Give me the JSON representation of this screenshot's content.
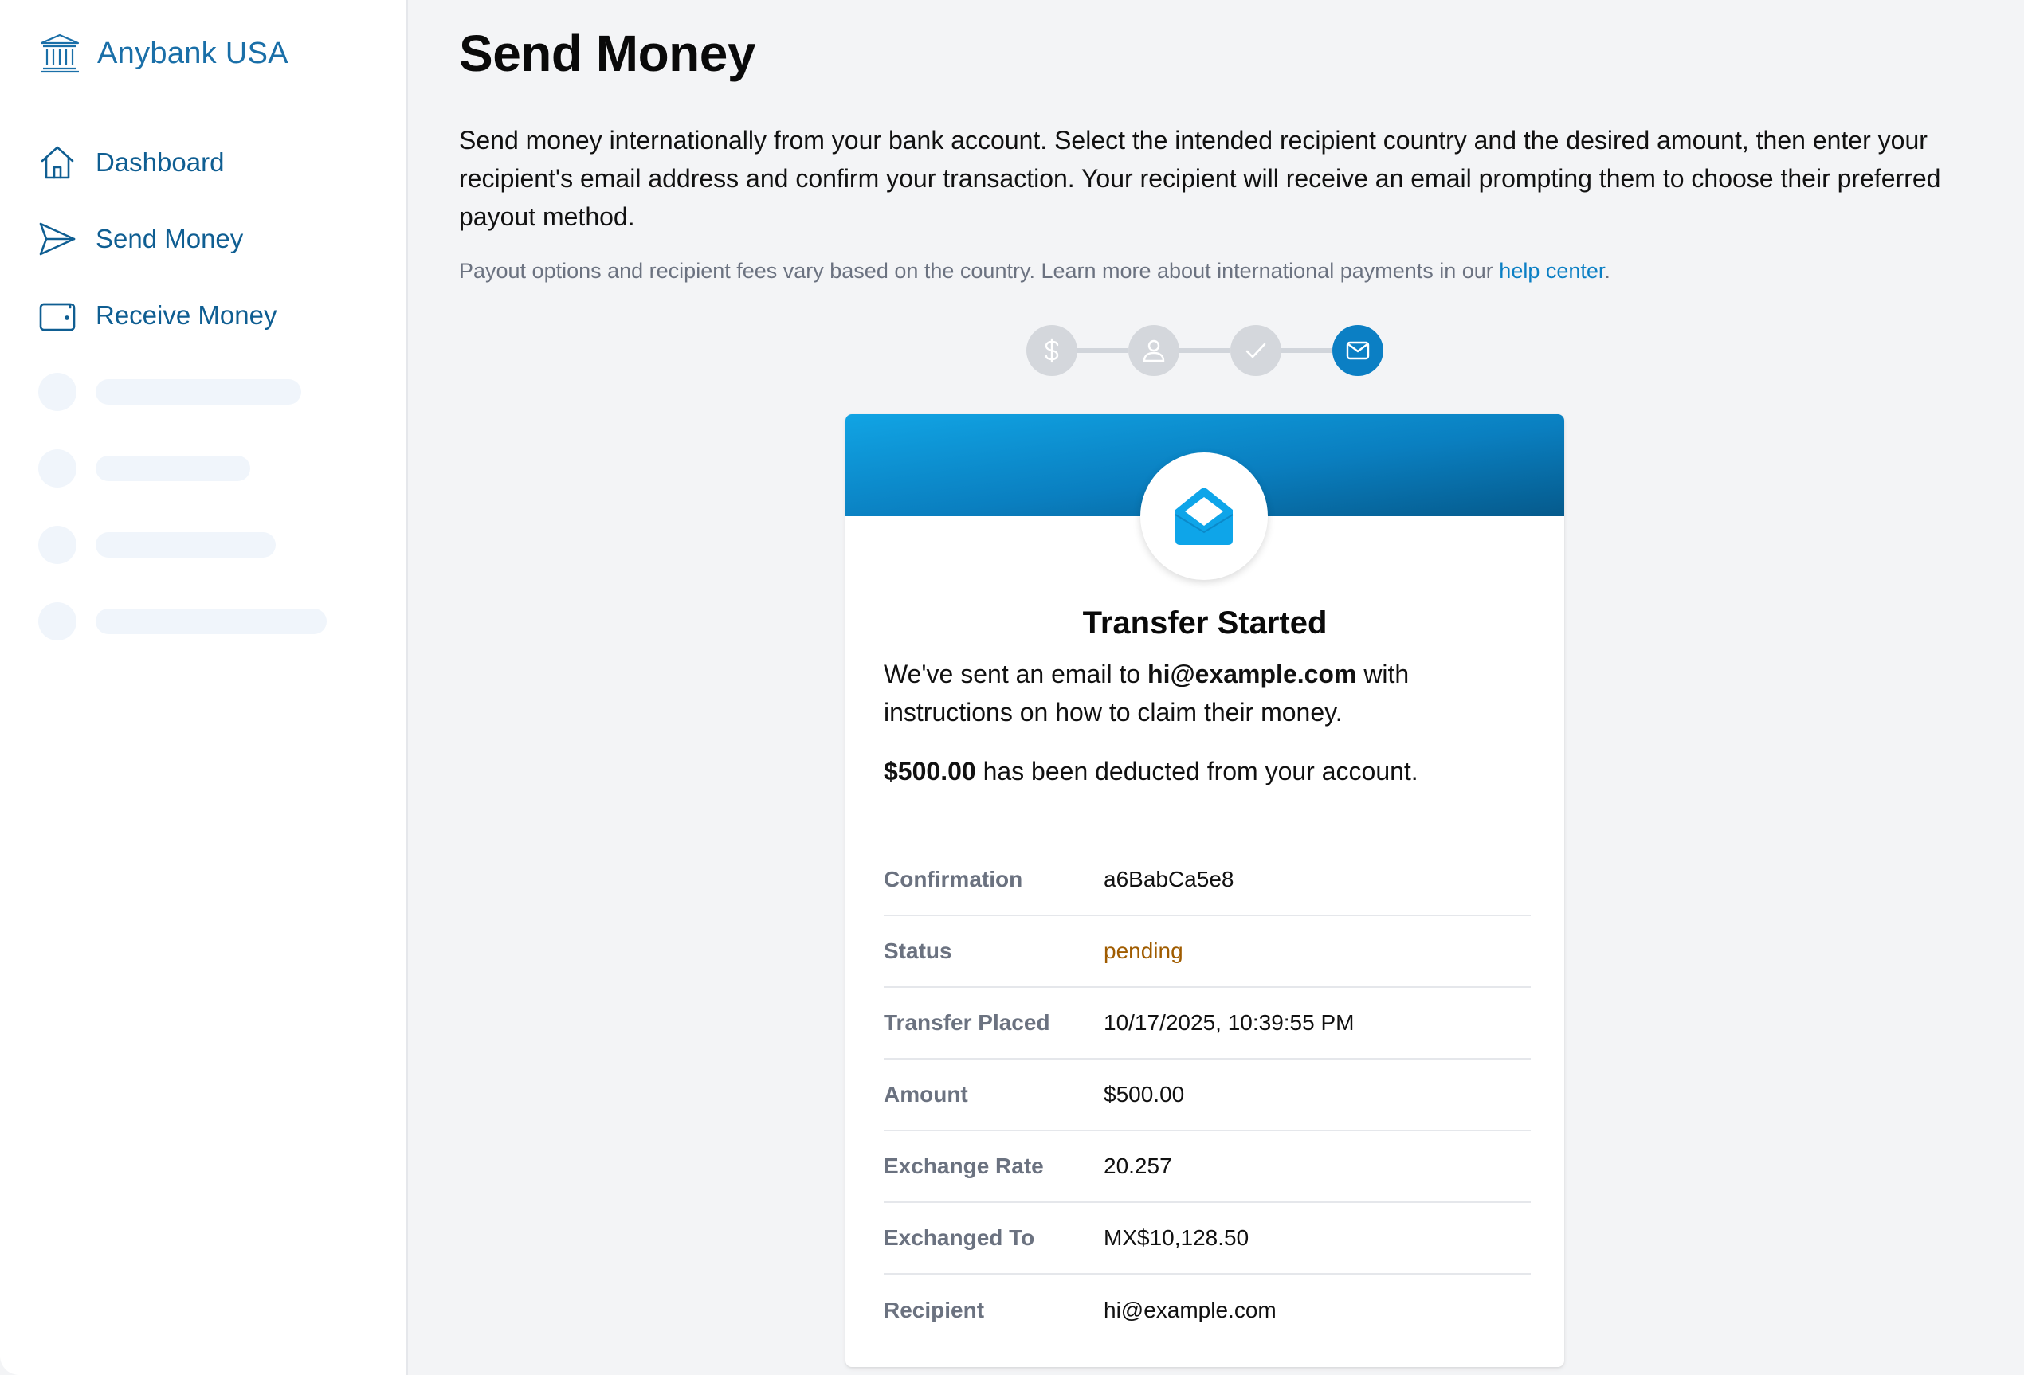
{
  "brand": {
    "name": "Anybank USA"
  },
  "sidebar": {
    "items": [
      {
        "label": "Dashboard",
        "icon": "home-icon"
      },
      {
        "label": "Send Money",
        "icon": "paper-plane-icon"
      },
      {
        "label": "Receive Money",
        "icon": "wallet-icon"
      }
    ]
  },
  "page": {
    "title": "Send Money",
    "intro": "Send money internationally from your bank account. Select the intended recipient country and the desired amount, then enter your recipient's email address and confirm your transaction. Your recipient will receive an email prompting them to choose their preferred payout method.",
    "note_prefix": "Payout options and recipient fees vary based on the country. Learn more about international payments in our ",
    "note_link": "help center",
    "note_suffix": "."
  },
  "stepper": {
    "steps": [
      {
        "icon": "dollar-icon",
        "state": "done"
      },
      {
        "icon": "user-icon",
        "state": "done"
      },
      {
        "icon": "check-icon",
        "state": "done"
      },
      {
        "icon": "mail-icon",
        "state": "active"
      }
    ],
    "colors": {
      "inactive": "#d4d7dc",
      "active": "#0b7fc4"
    }
  },
  "card": {
    "badge_icon": "open-envelope-icon",
    "title": "Transfer Started",
    "msg_prefix": "We've sent an email to ",
    "msg_email": "hi@example.com",
    "msg_suffix": " with instructions on how to claim their money.",
    "deduct_amount": "$500.00",
    "deduct_suffix": " has been deducted from your account.",
    "details": [
      {
        "label": "Confirmation",
        "value": "a6BabCa5e8"
      },
      {
        "label": "Status",
        "value": "pending"
      },
      {
        "label": "Transfer Placed",
        "value": "10/17/2025, 10:39:55 PM"
      },
      {
        "label": "Amount",
        "value": "$500.00"
      },
      {
        "label": "Exchange Rate",
        "value": "20.257"
      },
      {
        "label": "Exchanged To",
        "value": "MX$10,128.50"
      },
      {
        "label": "Recipient",
        "value": "hi@example.com"
      }
    ],
    "colors": {
      "header_start": "#11a4e4",
      "header_end": "#055a8c",
      "status_pending": "#a05c00"
    }
  }
}
